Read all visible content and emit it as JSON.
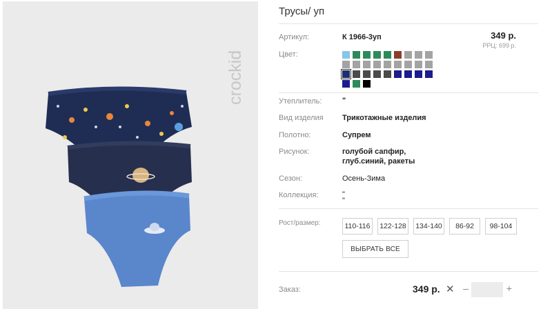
{
  "product": {
    "title": "Трусы/ уп",
    "brand": "crockid",
    "price": "349 р.",
    "rrp": "РРЦ: 699 р."
  },
  "details": {
    "article_label": "Артикул:",
    "article_value": "К 1966-3уп",
    "color_label": "Цвет:",
    "insulation_label": "Утеплитель:",
    "insulation_value": "\"",
    "type_label": "Вид изделия",
    "type_value": "Трикотажные изделия",
    "fabric_label": "Полотно:",
    "fabric_value": "Супрем",
    "pattern_label": "Рисунок:",
    "pattern_line1": "голубой сапфир,",
    "pattern_line2": "глуб.синий, ракеты",
    "season_label": "Сезон:",
    "season_value": "Осень-Зима",
    "collection_label": "Коллекция:",
    "collection_line1": "\"",
    "collection_line2": "\""
  },
  "colors": [
    "#87c5ea",
    "#2e8a5a",
    "#2e8a5a",
    "#2e8a5a",
    "#2e8a5a",
    "#8b3f2a",
    "#a3a3a3",
    "#a3a3a3",
    "#a3a3a3",
    "#a3a3a3",
    "#a3a3a3",
    "#a3a3a3",
    "#a3a3a3",
    "#a3a3a3",
    "#a3a3a3",
    "#a3a3a3",
    "#a3a3a3",
    "#a3a3a3",
    "#1f2f6d",
    "#4b4b4b",
    "#4b4b4b",
    "#4b4b4b",
    "#4b4b4b",
    "#1c1c8c",
    "#1c1c8c",
    "#1c1c8c",
    "#1c1c8c",
    "#1c1c8c",
    "#2e8a5a",
    "#000000"
  ],
  "sizes": {
    "label": "Рост/размер:",
    "options": [
      "110-116",
      "122-128",
      "134-140",
      "86-92",
      "98-104"
    ],
    "select_all": "ВЫБРАТЬ ВСЕ"
  },
  "order": {
    "label": "Заказ:",
    "price": "349 р.",
    "remove_glyph": "✕",
    "minus_glyph": "–",
    "plus_glyph": "+"
  }
}
